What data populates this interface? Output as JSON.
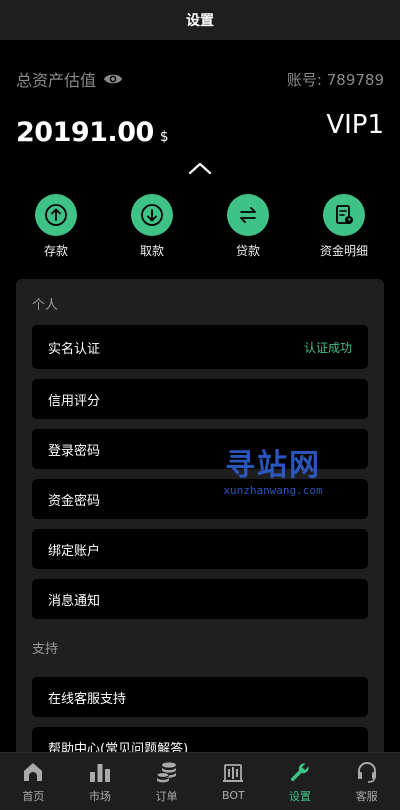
{
  "header": {
    "title": "设置"
  },
  "assets": {
    "label": "总资产估值",
    "account": "账号: 789789",
    "amount": "20191.00",
    "unit": "$",
    "vip": "VIP1"
  },
  "actions": [
    {
      "label": "存款",
      "icon": "deposit-icon"
    },
    {
      "label": "取款",
      "icon": "withdraw-icon"
    },
    {
      "label": "贷款",
      "icon": "loan-icon"
    },
    {
      "label": "资金明细",
      "icon": "ledger-icon"
    }
  ],
  "personal": {
    "title": "个人",
    "items": [
      {
        "label": "实名认证",
        "status": "认证成功"
      },
      {
        "label": "信用评分"
      },
      {
        "label": "登录密码"
      },
      {
        "label": "资金密码"
      },
      {
        "label": "绑定账户"
      },
      {
        "label": "消息通知"
      }
    ]
  },
  "support": {
    "title": "支持",
    "items": [
      {
        "label": "在线客服支持"
      },
      {
        "label": "帮助中心(常见问题解答)"
      }
    ]
  },
  "watermark": {
    "main": "寻站网",
    "sub": "xunzhanwang.com"
  },
  "tabs": [
    {
      "label": "首页",
      "icon": "home-icon"
    },
    {
      "label": "市场",
      "icon": "bar-chart-icon"
    },
    {
      "label": "订单",
      "icon": "coin-stack-icon"
    },
    {
      "label": "BOT",
      "icon": "bot-icon"
    },
    {
      "label": "设置",
      "icon": "wrench-icon",
      "active": true
    },
    {
      "label": "客服",
      "icon": "headset-icon"
    }
  ],
  "colors": {
    "accent": "#3fc285",
    "background": "#000000",
    "panel": "#1f1f1f",
    "bar": "#1e1e1e",
    "watermark": "#2f5fd0"
  }
}
